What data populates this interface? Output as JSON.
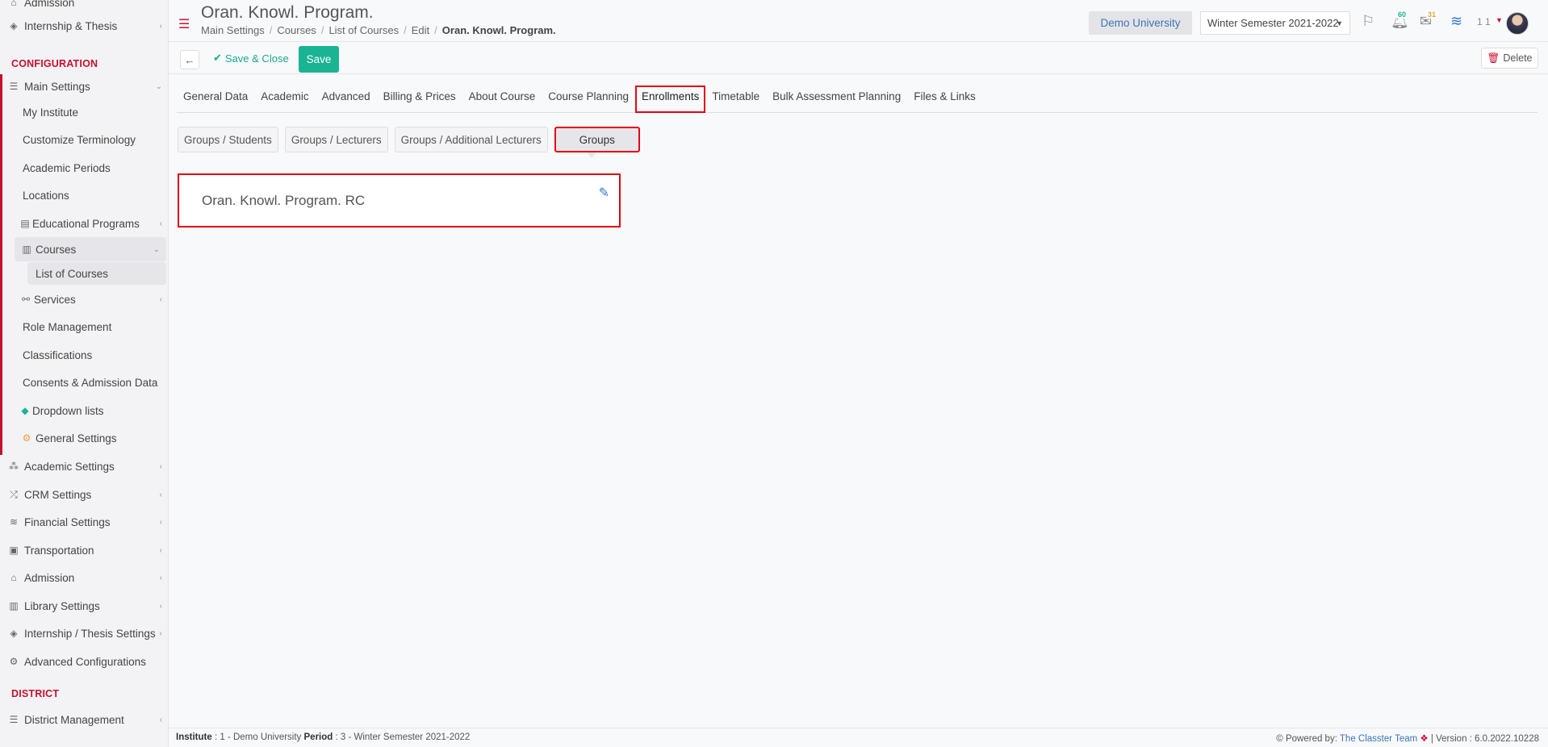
{
  "sidebar": {
    "top_items": [
      {
        "label": "Admission"
      },
      {
        "label": "Internship & Thesis"
      }
    ],
    "section_configuration": "CONFIGURATION",
    "main_settings": "Main Settings",
    "sub_items": {
      "my_institute": "My Institute",
      "customize_terminology": "Customize Terminology",
      "academic_periods": "Academic Periods",
      "locations": "Locations",
      "educational_programs": "Educational Programs",
      "courses": "Courses",
      "list_of_courses": "List of Courses",
      "services": "Services",
      "role_management": "Role Management",
      "classifications": "Classifications",
      "consents": "Consents & Admission Data",
      "dropdown_lists": "Dropdown lists",
      "general_settings": "General Settings"
    },
    "items": {
      "academic_settings": "Academic Settings",
      "crm_settings": "CRM Settings",
      "financial_settings": "Financial Settings",
      "transportation": "Transportation",
      "admission": "Admission",
      "library_settings": "Library Settings",
      "internship_thesis_settings": "Internship / Thesis Settings",
      "advanced_configurations": "Advanced Configurations"
    },
    "section_district": "DISTRICT",
    "district_management": "District Management"
  },
  "header": {
    "title": "Oran. Knowl. Program.",
    "breadcrumb": [
      "Main Settings",
      "Courses",
      "List of Courses",
      "Edit",
      "Oran. Knowl. Program."
    ],
    "university": "Demo University",
    "semester": "Winter Semester 2021-2022",
    "notifications_count": "60",
    "messages_count": "31",
    "user_number": "1 1"
  },
  "toolbar": {
    "save_close": "Save & Close",
    "save": "Save",
    "delete": "Delete"
  },
  "tabs": [
    "General Data",
    "Academic",
    "Advanced",
    "Billing & Prices",
    "About Course",
    "Course Planning",
    "Enrollments",
    "Timetable",
    "Bulk Assessment Planning",
    "Files & Links"
  ],
  "active_tab": "Enrollments",
  "subtabs": [
    "Groups / Students",
    "Groups / Lecturers",
    "Groups / Additional Lecturers",
    "Groups"
  ],
  "group": {
    "name": "Oran. Knowl. Program. RC"
  },
  "footer": {
    "institute_label": "Institute",
    "institute_value": ": 1 - Demo University",
    "period_label": "Period",
    "period_value": ": 3 - Winter Semester 2021-2022",
    "powered_by": "Powered by:",
    "team": "The Classter Team",
    "version": "| Version : 6.0.2022.10228"
  },
  "colors": {
    "accent_red": "#c8102e",
    "save_green": "#1ab394",
    "link_blue": "#3a74b6"
  }
}
